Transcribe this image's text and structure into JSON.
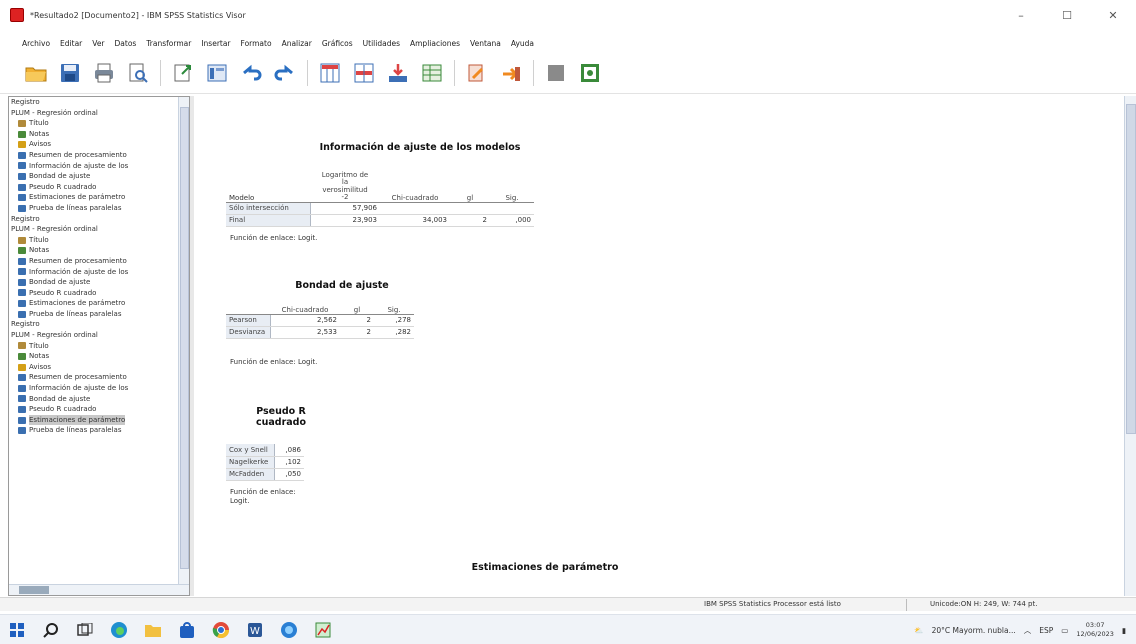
{
  "window": {
    "title": "*Resultado2 [Documento2] - IBM SPSS Statistics Visor",
    "minimize": "–",
    "maximize": "☐",
    "close": "✕"
  },
  "menu": [
    "Archivo",
    "Editar",
    "Ver",
    "Datos",
    "Transformar",
    "Insertar",
    "Formato",
    "Analizar",
    "Gráficos",
    "Utilidades",
    "Ampliaciones",
    "Ventana",
    "Ayuda"
  ],
  "toolbar": {
    "icons": [
      "open-icon",
      "save-icon",
      "print-icon",
      "print-preview-icon",
      "export-icon",
      "recall-dialog-icon",
      "undo-icon",
      "redo-icon",
      "goto-data-icon",
      "goto-case-icon",
      "variables-icon",
      "insert-table-icon",
      "insert-chart-icon",
      "designate-window-icon",
      "hide-icon",
      "show-icon"
    ]
  },
  "outline": {
    "items": [
      {
        "label": "Registro",
        "level": "top",
        "icon": "none"
      },
      {
        "label": "PLUM - Regresión ordinal",
        "level": "top",
        "icon": "none"
      },
      {
        "label": "Título",
        "level": "child",
        "icon": "title-icon"
      },
      {
        "label": "Notas",
        "level": "child",
        "icon": "note-icon"
      },
      {
        "label": "Avisos",
        "level": "child",
        "icon": "warning-icon"
      },
      {
        "label": "Resumen de procesamiento",
        "level": "child",
        "icon": "table-icon"
      },
      {
        "label": "Información de ajuste de los",
        "level": "child",
        "icon": "table-icon"
      },
      {
        "label": "Bondad de ajuste",
        "level": "child",
        "icon": "table-icon"
      },
      {
        "label": "Pseudo R cuadrado",
        "level": "child",
        "icon": "table-icon"
      },
      {
        "label": "Estimaciones de parámetro",
        "level": "child",
        "icon": "table-icon"
      },
      {
        "label": "Prueba de líneas paralelas",
        "level": "child",
        "icon": "table-icon"
      },
      {
        "label": "Registro",
        "level": "top",
        "icon": "none"
      },
      {
        "label": "PLUM - Regresión ordinal",
        "level": "top",
        "icon": "none"
      },
      {
        "label": "Título",
        "level": "child",
        "icon": "title-icon"
      },
      {
        "label": "Notas",
        "level": "child",
        "icon": "note-icon"
      },
      {
        "label": "Resumen de procesamiento",
        "level": "child",
        "icon": "table-icon"
      },
      {
        "label": "Información de ajuste de los",
        "level": "child",
        "icon": "table-icon"
      },
      {
        "label": "Bondad de ajuste",
        "level": "child",
        "icon": "table-icon"
      },
      {
        "label": "Pseudo R cuadrado",
        "level": "child",
        "icon": "table-icon"
      },
      {
        "label": "Estimaciones de parámetro",
        "level": "child",
        "icon": "table-icon"
      },
      {
        "label": "Prueba de líneas paralelas",
        "level": "child",
        "icon": "table-icon"
      },
      {
        "label": "Registro",
        "level": "top",
        "icon": "none"
      },
      {
        "label": "PLUM - Regresión ordinal",
        "level": "top",
        "icon": "none"
      },
      {
        "label": "Título",
        "level": "child",
        "icon": "title-icon"
      },
      {
        "label": "Notas",
        "level": "child",
        "icon": "note-icon"
      },
      {
        "label": "Avisos",
        "level": "child",
        "icon": "warning-icon"
      },
      {
        "label": "Resumen de procesamiento",
        "level": "child",
        "icon": "table-icon"
      },
      {
        "label": "Información de ajuste de los",
        "level": "child",
        "icon": "table-icon"
      },
      {
        "label": "Bondad de ajuste",
        "level": "child",
        "icon": "table-icon"
      },
      {
        "label": "Pseudo R cuadrado",
        "level": "child",
        "icon": "table-icon"
      },
      {
        "label": "Estimaciones de parámetro",
        "level": "child",
        "icon": "table-icon",
        "selected": true
      },
      {
        "label": "Prueba de líneas paralelas",
        "level": "child",
        "icon": "table-icon"
      }
    ]
  },
  "model_fit": {
    "title": "Información de ajuste de los modelos",
    "col_modelo": "Modelo",
    "col_loglik_l1": "Logaritmo de",
    "col_loglik_l2": "la",
    "col_loglik_l3": "verosimilitud",
    "col_loglik_l4": "-2",
    "col_chi": "Chi-cuadrado",
    "col_gl": "gl",
    "col_sig": "Sig.",
    "rows": [
      {
        "label": "Sólo intersección",
        "loglik": "57,906",
        "chi": "",
        "gl": "",
        "sig": ""
      },
      {
        "label": "Final",
        "loglik": "23,903",
        "chi": "34,003",
        "gl": "2",
        "sig": ",000"
      }
    ],
    "footnote": "Función de enlace: Logit."
  },
  "goodness": {
    "title": "Bondad de ajuste",
    "col_chi": "Chi-cuadrado",
    "col_gl": "gl",
    "col_sig": "Sig.",
    "rows": [
      {
        "label": "Pearson",
        "chi": "2,562",
        "gl": "2",
        "sig": ",278"
      },
      {
        "label": "Desvianza",
        "chi": "2,533",
        "gl": "2",
        "sig": ",282"
      }
    ],
    "footnote": "Función de enlace: Logit."
  },
  "pseudo_r2": {
    "title_l1": "Pseudo R",
    "title_l2": "cuadrado",
    "rows": [
      {
        "label": "Cox y Snell",
        "value": ",086"
      },
      {
        "label": "Nagelkerke",
        "value": ",102"
      },
      {
        "label": "McFadden",
        "value": ",050"
      }
    ],
    "footnote_l1": "Función de enlace:",
    "footnote_l2": "Logit."
  },
  "estimates": {
    "title": "Estimaciones de parámetro"
  },
  "status": {
    "processor": "IBM SPSS Statistics Processor está listo",
    "encoding": "Unicode:ON  H: 249, W: 744 pt."
  },
  "taskbar": {
    "weather": "20°C  Mayorm. nubla...",
    "lang": "ESP",
    "time": "03:07",
    "date": "12/06/2023"
  }
}
